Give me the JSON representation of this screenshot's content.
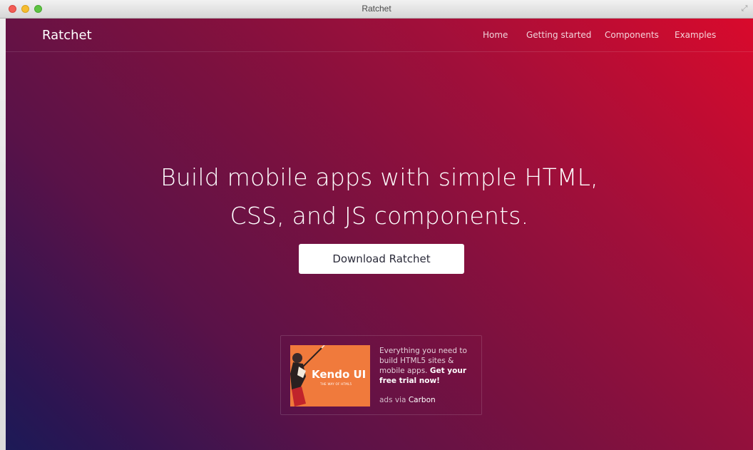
{
  "window": {
    "title": "Ratchet"
  },
  "navbar": {
    "brand": "Ratchet",
    "links": [
      {
        "label": "Home"
      },
      {
        "label": "Getting started"
      },
      {
        "label": "Components"
      },
      {
        "label": "Examples"
      }
    ]
  },
  "hero": {
    "headline_line1": "Build mobile apps with simple HTML,",
    "headline_line2": "CSS, and JS components.",
    "download_label": "Download Ratchet"
  },
  "ad": {
    "image_brand": "Kendo UI",
    "image_tagline": "THE WAY OF HTML5",
    "text_plain": "Everything you need to build HTML5 sites & mobile apps.",
    "text_bold": "Get your free trial now!",
    "via_prefix": "ads via",
    "via_name": "Carbon"
  },
  "colors": {
    "gradient_top_right": "#d90a2c",
    "gradient_bottom_left": "#1c1a57",
    "button_bg": "#ffffff",
    "ad_image_bg": "#f07a3c"
  },
  "icons": {
    "close": "traffic-close-icon",
    "minimize": "traffic-minimize-icon",
    "zoom": "traffic-zoom-icon",
    "fullscreen": "fullscreen-icon"
  }
}
